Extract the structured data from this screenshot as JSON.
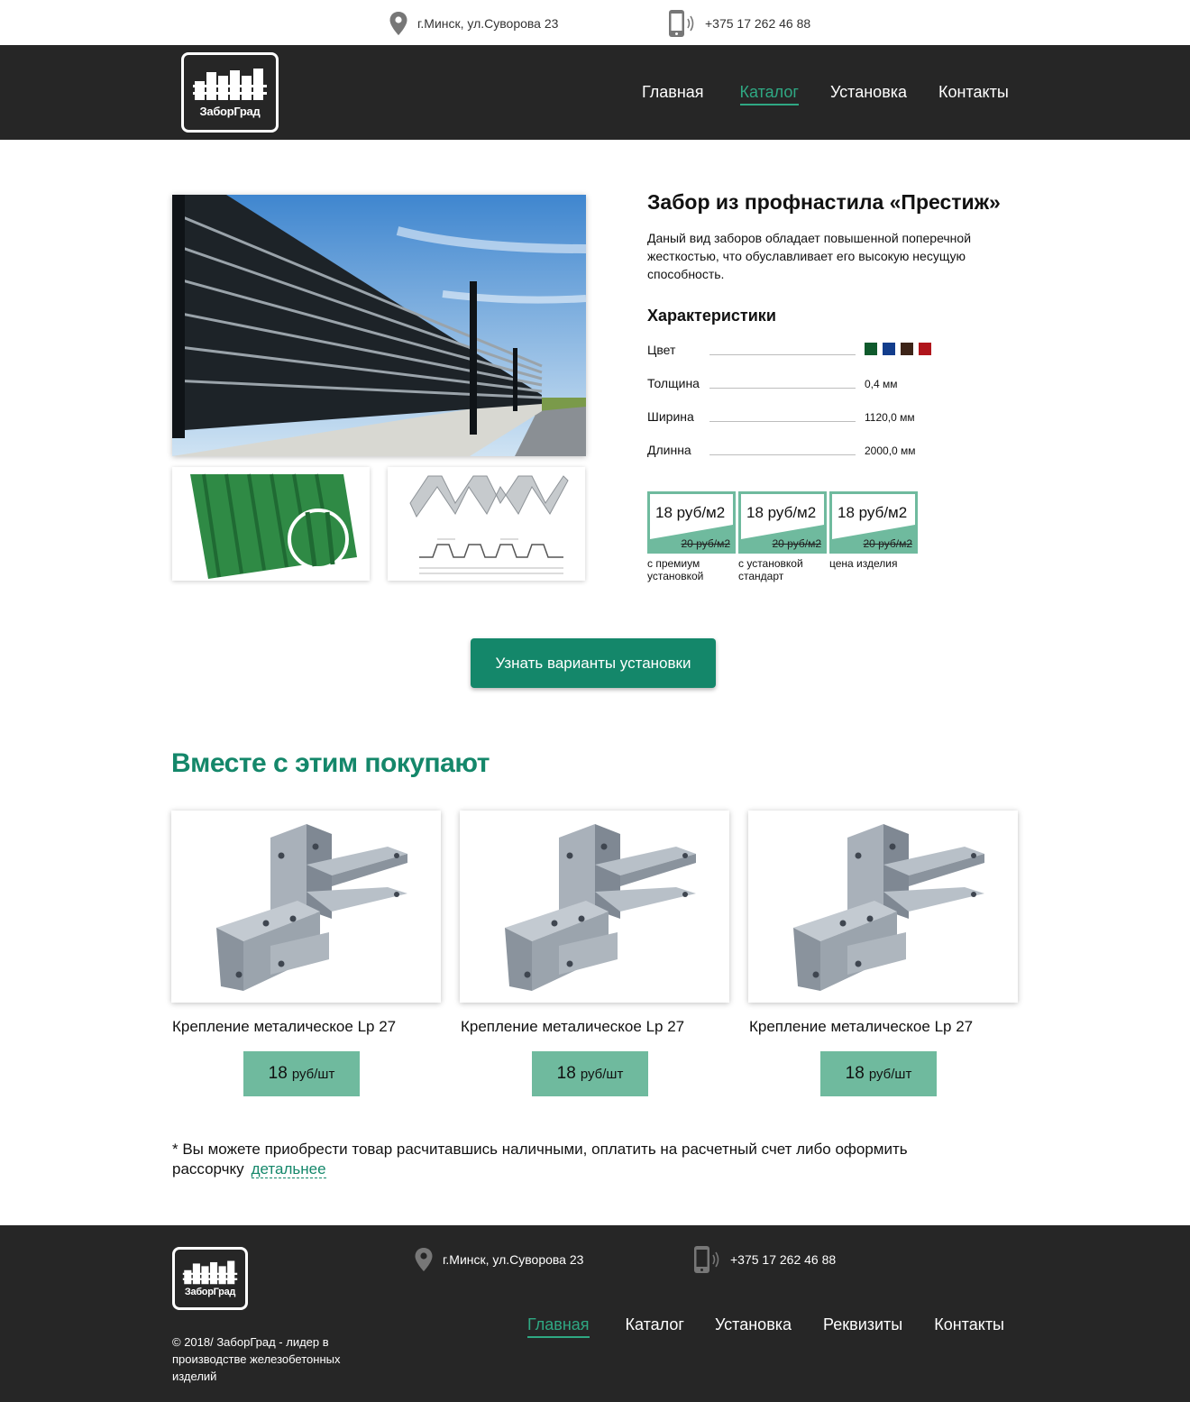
{
  "topbar": {
    "address": "г.Минск, ул.Суворова 23",
    "phone": "+375 17 262 46 88"
  },
  "header": {
    "logo_text": "ЗаборГрад",
    "nav": [
      {
        "label": "Главная",
        "active": false
      },
      {
        "label": "Каталог",
        "active": true
      },
      {
        "label": "Установка",
        "active": false
      },
      {
        "label": "Контакты",
        "active": false
      }
    ]
  },
  "product": {
    "title": "Забор из профнастила «Престиж»",
    "description": "Даный вид заборов обладает повышенной поперечной жесткостью, что обуславливает его высокую несущую способность.",
    "specs_title": "Характеристики",
    "specs": [
      {
        "label": "Цвет",
        "value": ""
      },
      {
        "label": "Толщина",
        "value": "0,4 мм"
      },
      {
        "label": "Ширина",
        "value": "1120,0 мм"
      },
      {
        "label": "Длинна",
        "value": "2000,0 мм"
      }
    ],
    "colors": [
      "#0f5a2c",
      "#123d8c",
      "#3d2418",
      "#b0151c"
    ],
    "prices": [
      {
        "price": "18 руб/м2",
        "old": "20 руб/м2",
        "caption": "с премиум установкой"
      },
      {
        "price": "18 руб/м2",
        "old": "20 руб/м2",
        "caption": "с установкой стандарт"
      },
      {
        "price": "18 руб/м2",
        "old": "20 руб/м2",
        "caption": "цена изделия"
      }
    ],
    "cta_label": "Узнать варианты установки"
  },
  "related": {
    "title": "Вместе с этим покупают",
    "items": [
      {
        "name": "Крепление металическое Lp 27",
        "price": "18",
        "unit": "руб/шт"
      },
      {
        "name": "Крепление металическое Lp 27",
        "price": "18",
        "unit": "руб/шт"
      },
      {
        "name": "Крепление металическое Lp 27",
        "price": "18",
        "unit": "руб/шт"
      }
    ]
  },
  "note": {
    "text": "* Вы можете приобрести товар расчитавшись наличными, оплатить на расчетный счет либо оформить рассорчку",
    "link": "детальнее"
  },
  "footer": {
    "logo_text": "ЗаборГрад",
    "address": "г.Минск, ул.Суворова 23",
    "phone": "+375 17 262 46 88",
    "nav": [
      {
        "label": "Главная",
        "active": true
      },
      {
        "label": "Каталог",
        "active": false
      },
      {
        "label": "Установка",
        "active": false
      },
      {
        "label": "Реквизиты",
        "active": false
      },
      {
        "label": "Контакты",
        "active": false
      }
    ],
    "copyright": "© 2018/ ЗаборГрад - лидер в производстве железобетонных изделий"
  },
  "icons": {
    "location": "map-pin-icon",
    "phone": "mobile-phone-icon",
    "accent": "#14876a",
    "price_accent": "#6fba9e"
  }
}
